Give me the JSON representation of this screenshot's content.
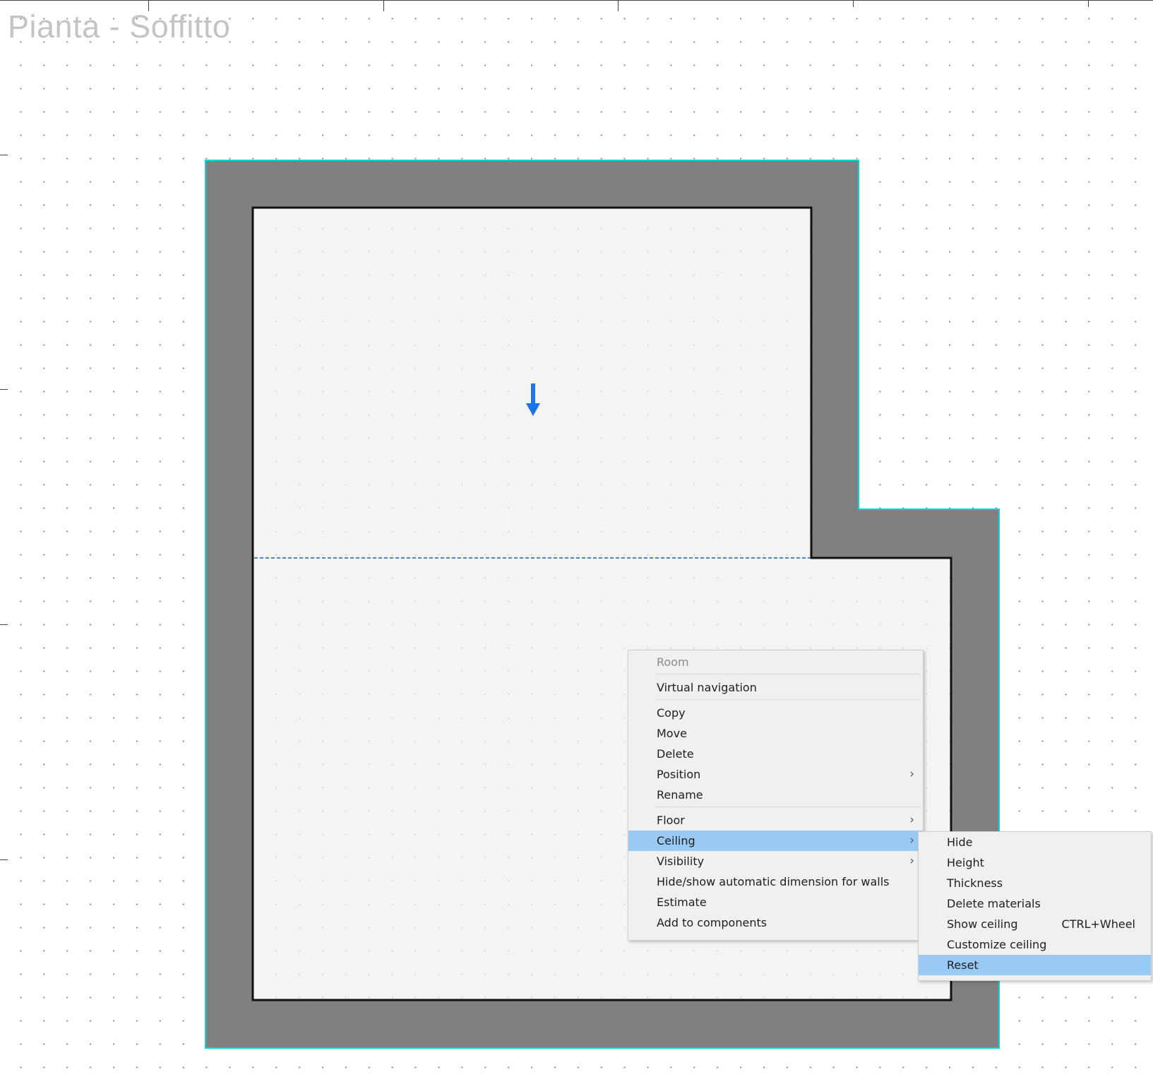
{
  "view": {
    "title": "Pianta - Soffitto"
  },
  "context_menu": {
    "header": "Room",
    "items": {
      "virtual_navigation": "Virtual navigation",
      "copy": "Copy",
      "move": "Move",
      "delete": "Delete",
      "position": "Position",
      "rename": "Rename",
      "floor": "Floor",
      "ceiling": "Ceiling",
      "visibility": "Visibility",
      "hide_show_dimension": "Hide/show automatic dimension for walls",
      "estimate": "Estimate",
      "add_to_components": "Add to components"
    },
    "submenu_arrow": "›",
    "highlighted": "Ceiling"
  },
  "ceiling_submenu": {
    "items": {
      "hide": "Hide",
      "height": "Height",
      "thickness": "Thickness",
      "delete_materials": "Delete materials",
      "show_ceiling": "Show ceiling",
      "show_ceiling_shortcut": "CTRL+Wheel",
      "customize_ceiling": "Customize ceiling",
      "reset": "Reset"
    },
    "highlighted": "Reset"
  },
  "colors": {
    "wall": "#808080",
    "floor": "#f0f0f0",
    "selection_outline": "#00d8d8",
    "arrow": "#1a73e8",
    "menu_highlight": "#99c9f5"
  },
  "icons": {
    "direction_arrow": "down-arrow-icon"
  }
}
